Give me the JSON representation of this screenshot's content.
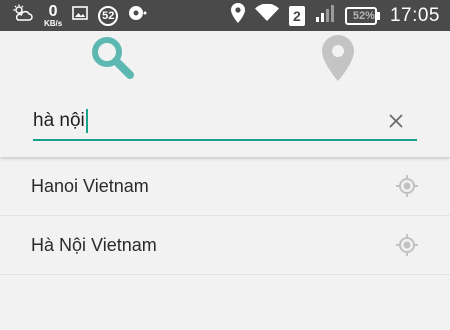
{
  "status_bar": {
    "net_speed_value": "0",
    "net_speed_unit": "KB/s",
    "notification_count": "52",
    "sim_slot": "2",
    "battery_percent": "52%",
    "battery_level": 0.52,
    "time": "17:05"
  },
  "tabs": [
    {
      "icon": "search-icon",
      "selected": true,
      "color": "#5cb8b0"
    },
    {
      "icon": "place-pin-icon",
      "selected": false,
      "color": "#c4c4c4"
    }
  ],
  "search": {
    "value": "hà nội",
    "accent": "#17a28c"
  },
  "results": [
    {
      "label": "Hanoi Vietnam",
      "icon": "locate-icon"
    },
    {
      "label": "Hà Nội Vietnam",
      "icon": "locate-icon"
    }
  ]
}
